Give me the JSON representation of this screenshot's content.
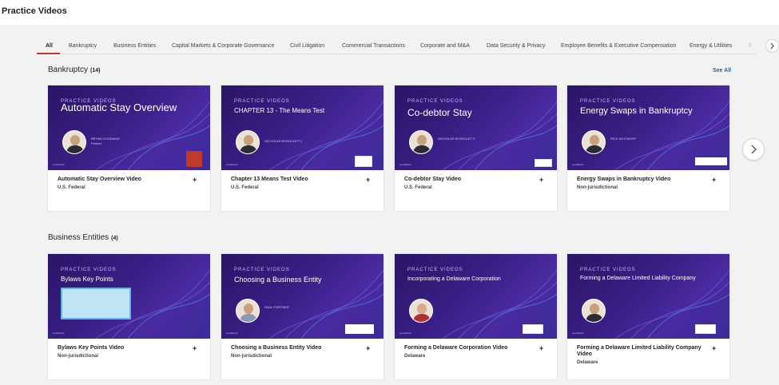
{
  "page": {
    "title": "Practice Videos"
  },
  "tabs": [
    "All",
    "Bankruptcy",
    "Business Entities",
    "Capital Markets & Corporate Governance",
    "Civil Litigation",
    "Commercial Transactions",
    "Corporate and M&A",
    "Data Security & Privacy",
    "Employee Benefits & Executive Compensation",
    "Energy & Utilities",
    "F"
  ],
  "active_tab": "All",
  "sections": [
    {
      "title": "Bankruptcy",
      "count": "(14)",
      "see_all": "See All",
      "cards": [
        {
          "eyebrow": "PRACTICE VIDEOS",
          "thumb_title": "Automatic Stay Overview",
          "presenter_name": "BRYAN GOODMAN",
          "presenter_role": "Partner",
          "caption": "Automatic Stay Overview Video",
          "jurisdiction": "U.S. Federal",
          "brand": "LexisNexis"
        },
        {
          "eyebrow": "PRACTICE VIDEOS",
          "thumb_title": "CHAPTER 13 - The Means Test",
          "presenter_name": "NICHOLAS BOSSOLETTI",
          "presenter_role": "",
          "caption": "Chapter 13 Means Test Video",
          "jurisdiction": "U.S. Federal",
          "brand": "LexisNexis"
        },
        {
          "eyebrow": "PRACTICE VIDEOS",
          "thumb_title": "Co-debtor Stay",
          "presenter_name": "NICHOLAS BOSSOLETTI",
          "presenter_role": "",
          "caption": "Co-debtor Stay Video",
          "jurisdiction": "U.S. Federal",
          "brand": "LexisNexis"
        },
        {
          "eyebrow": "PRACTICE VIDEOS",
          "thumb_title": "Energy Swaps in Bankruptcy",
          "presenter_name": "RICK ANTONOFF",
          "presenter_role": "",
          "caption": "Energy Swaps in Bankruptcy Video",
          "jurisdiction": "Non-jurisdictional",
          "brand": "LexisNexis"
        }
      ]
    },
    {
      "title": "Business Entities",
      "count": "(4)",
      "cards": [
        {
          "eyebrow": "PRACTICE VIDEOS",
          "thumb_title": "Bylaws Key Points",
          "presenter_name": "",
          "presenter_role": "",
          "caption": "Bylaws Key Points Video",
          "jurisdiction": "Non-jurisdictional",
          "brand": "LexisNexis"
        },
        {
          "eyebrow": "PRACTICE VIDEOS",
          "thumb_title": "Choosing a Business Entity",
          "presenter_name": "PAUL PORTNER",
          "presenter_role": "",
          "caption": "Choosing a Business Entity Video",
          "jurisdiction": "Non-jurisdictional",
          "brand": "LexisNexis"
        },
        {
          "eyebrow": "PRACTICE VIDEOS",
          "thumb_title": "Incorporating a Delaware Corporation",
          "presenter_name": "",
          "presenter_role": "",
          "caption": "Forming a Delaware Corporation Video",
          "jurisdiction": "Delaware",
          "brand": "LexisNexis"
        },
        {
          "eyebrow": "PRACTICE VIDEOS",
          "thumb_title": "Forming a Delaware Limited Liability Company",
          "presenter_name": "",
          "presenter_role": "",
          "caption": "Forming a Delaware Limited Liability Company Video",
          "jurisdiction": "Delaware",
          "brand": "LexisNexis"
        }
      ]
    }
  ],
  "icons": {
    "card_add": "plus-icon",
    "carousel_next": "chevron-right-icon",
    "tabs_next": "chevron-right-icon"
  },
  "colors": {
    "accent": "#c0392b",
    "link": "#2a5db0",
    "thumb_bg": "#3a1f86"
  }
}
